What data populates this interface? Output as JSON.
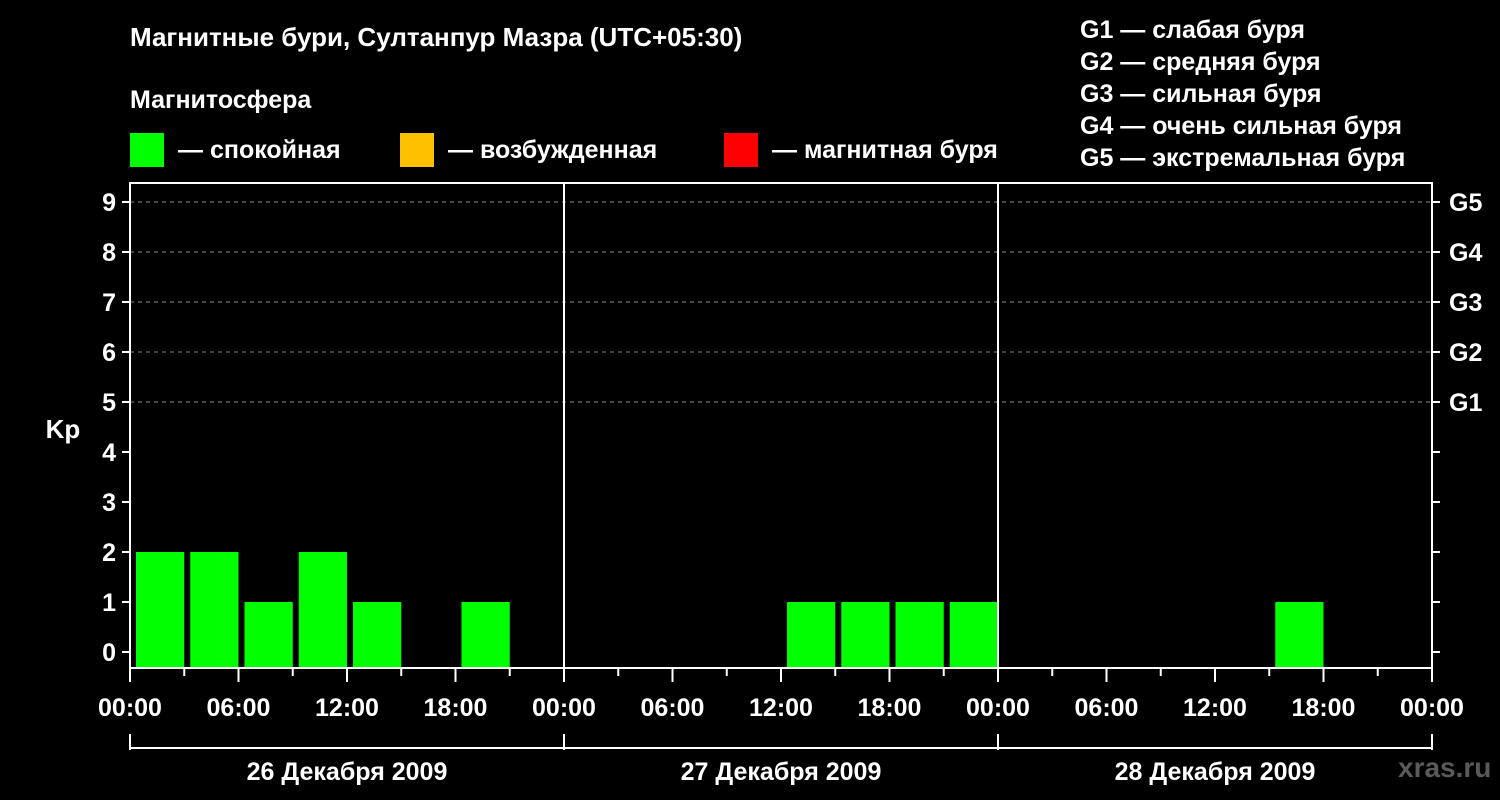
{
  "title": "Магнитные бури, Султанпур Мазра (UTC+05:30)",
  "legend": {
    "heading": "Магнитосфера",
    "items": [
      {
        "label": "— спокойная",
        "color": "#00ff00"
      },
      {
        "label": "— возбужденная",
        "color": "#ffc000"
      },
      {
        "label": "— магнитная буря",
        "color": "#ff0000"
      }
    ]
  },
  "g_legend": [
    "G1 — слабая буря",
    "G2 — средняя буря",
    "G3 — сильная буря",
    "G4 — очень сильная буря",
    "G5 — экстремальная буря"
  ],
  "watermark": "xras.ru",
  "chart_data": {
    "type": "bar",
    "ylabel": "Kp",
    "ylim": [
      0,
      9
    ],
    "yticks": [
      0,
      1,
      2,
      3,
      4,
      5,
      6,
      7,
      8,
      9
    ],
    "g_scale": [
      {
        "kp": 5,
        "label": "G1"
      },
      {
        "kp": 6,
        "label": "G2"
      },
      {
        "kp": 7,
        "label": "G3"
      },
      {
        "kp": 8,
        "label": "G4"
      },
      {
        "kp": 9,
        "label": "G5"
      }
    ],
    "x_tick_labels": [
      "00:00",
      "06:00",
      "12:00",
      "18:00",
      "00:00",
      "06:00",
      "12:00",
      "18:00",
      "00:00",
      "06:00",
      "12:00",
      "18:00",
      "00:00"
    ],
    "days": [
      "26 Декабря 2009",
      "27 Декабря 2009",
      "28 Декабря 2009"
    ],
    "interval_hours": 3,
    "grid": "dashed horizontal at Kp 5-9",
    "series": [
      {
        "day": "26 Декабря 2009",
        "values": [
          2,
          2,
          1,
          2,
          1,
          0,
          1,
          0
        ],
        "color": "#00ff00"
      },
      {
        "day": "27 Декабря 2009",
        "values": [
          0,
          0,
          0,
          0,
          1,
          1,
          1,
          1
        ],
        "color": "#00ff00"
      },
      {
        "day": "28 Декабря 2009",
        "values": [
          0,
          0,
          0,
          0,
          0,
          1,
          0,
          0
        ],
        "color": "#00ff00"
      }
    ]
  }
}
